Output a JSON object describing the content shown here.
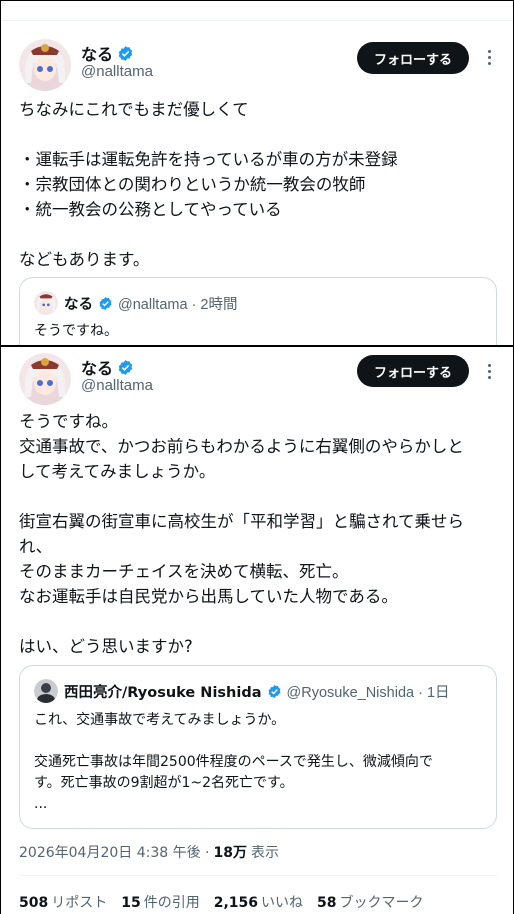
{
  "colors": {
    "accent": "#1d9bf0",
    "text": "#0f1419",
    "muted": "#536471",
    "border": "#cfd9de"
  },
  "tweet1": {
    "author_name": "なる",
    "author_handle": "@nalltama",
    "follow_label": "フォローする",
    "text": "ちなみにこれでもまだ優しくて\n\n・運転手は運転免許を持っているが車の方が未登録\n・宗教団体との関わりというか統一教会の牧師\n・統一教会の公務としてやっている\n\nなどもあります。",
    "quote": {
      "author_name": "なる",
      "author_meta": "@nalltama · 2時間",
      "text": "そうですね。"
    }
  },
  "tweet2": {
    "author_name": "なる",
    "author_handle": "@nalltama",
    "follow_label": "フォローする",
    "text": "そうですね。\n交通事故で、かつお前らもわかるように右翼側のやらかしと\nして考えてみましょうか。\n\n街宣右翼の街宣車に高校生が「平和学習」と騙されて乗せら\nれ、\nそのままカーチェイスを決めて横転、死亡。\nなお運転手は自民党から出馬していた人物である。\n\nはい、どう思いますか?",
    "quote": {
      "author_name": "西田亮介/Ryosuke Nishida",
      "author_meta": "@Ryosuke_Nishida · 1日",
      "text": "これ、交通事故で考えてみましょうか。\n\n交通死亡事故は年間2500件程度のペースで発生し、微減傾向で\nす。死亡事故の9割超が1~2名死亡です。\n..."
    },
    "timestamp": "2026年04月20日 4:38 午後 ·",
    "views_count": "18万",
    "views_label": "表示",
    "stats": {
      "reposts_count": "508",
      "reposts_label": "リポスト",
      "quotes_count": "15",
      "quotes_label": "件の引用",
      "likes_count": "2,156",
      "likes_label": "いいね",
      "bookmarks_count": "58",
      "bookmarks_label": "ブックマーク"
    }
  }
}
